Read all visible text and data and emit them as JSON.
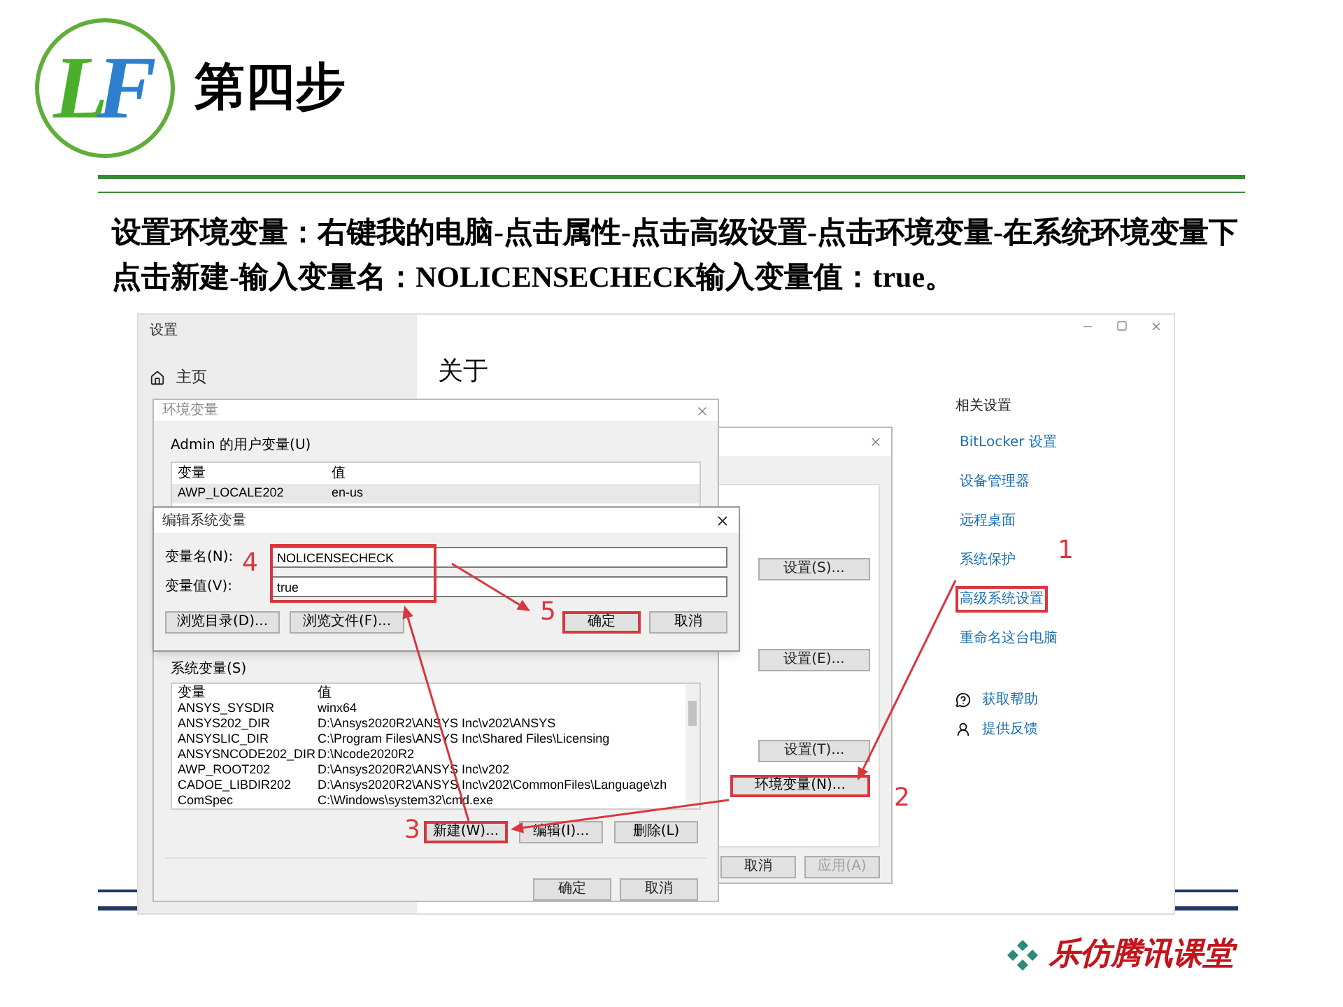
{
  "logo": {
    "letters": [
      "L",
      "F"
    ]
  },
  "title": "第四步",
  "instruction": "设置环境变量：右键我的电脑-点击属性-点击高级设置-点击环境变量-在系统环境变量下点击新建-输入变量名：NOLICENSECHECK输入变量值：true。",
  "settings_window": {
    "title": "设置",
    "nav": [
      {
        "label": "主页"
      }
    ],
    "page_title": "关于",
    "related_heading": "相关设置",
    "related_links": [
      {
        "label": "BitLocker 设置",
        "highlighted": false
      },
      {
        "label": "设备管理器",
        "highlighted": false
      },
      {
        "label": "远程桌面",
        "highlighted": false
      },
      {
        "label": "系统保护",
        "highlighted": false
      },
      {
        "label": "高级系统设置",
        "highlighted": true
      },
      {
        "label": "重命名这台电脑",
        "highlighted": false
      }
    ],
    "support_links": [
      {
        "label": "获取帮助",
        "kind": "help"
      },
      {
        "label": "提供反馈",
        "kind": "feedback"
      }
    ]
  },
  "system_properties": {
    "settings_buttons": [
      "设置(S)...",
      "设置(E)...",
      "设置(T)..."
    ],
    "env_button": {
      "label": "环境变量(N)...",
      "highlighted": true
    },
    "footer_buttons": [
      {
        "label": "取消",
        "disabled": false
      },
      {
        "label": "应用(A)",
        "disabled": true
      }
    ]
  },
  "env_window": {
    "title": "环境变量",
    "user_section": "Admin 的用户变量(U)",
    "user_columns": [
      "变量",
      "值"
    ],
    "user_rows": [
      {
        "name": "AWP_LOCALE202",
        "value": "en-us",
        "selected": true
      }
    ],
    "system_section": "系统变量(S)",
    "system_columns": [
      "变量",
      "值"
    ],
    "system_rows": [
      {
        "name": "ANSYS_SYSDIR",
        "value": "winx64"
      },
      {
        "name": "ANSYS202_DIR",
        "value": "D:\\Ansys2020R2\\ANSYS Inc\\v202\\ANSYS"
      },
      {
        "name": "ANSYSLIC_DIR",
        "value": "C:\\Program Files\\ANSYS Inc\\Shared Files\\Licensing"
      },
      {
        "name": "ANSYSNCODE202_DIR",
        "value": "D:\\Ncode2020R2"
      },
      {
        "name": "AWP_ROOT202",
        "value": "D:\\Ansys2020R2\\ANSYS Inc\\v202"
      },
      {
        "name": "CADOE_LIBDIR202",
        "value": "D:\\Ansys2020R2\\ANSYS Inc\\v202\\CommonFiles\\Language\\zh"
      },
      {
        "name": "ComSpec",
        "value": "C:\\Windows\\system32\\cmd.exe"
      }
    ],
    "action_buttons": [
      {
        "label": "新建(W)...",
        "highlighted": true
      },
      {
        "label": "编辑(I)...",
        "highlighted": false
      },
      {
        "label": "删除(L)",
        "highlighted": false
      }
    ],
    "footer_buttons": [
      "确定",
      "取消"
    ]
  },
  "edit_dialog": {
    "title": "编辑系统变量",
    "fields": [
      {
        "label": "变量名(N):",
        "value": "NOLICENSECHECK"
      },
      {
        "label": "变量值(V):",
        "value": "true"
      }
    ],
    "buttons": [
      {
        "label": "浏览目录(D)...",
        "highlighted": false
      },
      {
        "label": "浏览文件(F)...",
        "highlighted": false
      },
      {
        "label": "确定",
        "highlighted": true
      },
      {
        "label": "取消",
        "highlighted": false
      }
    ]
  },
  "annotations": {
    "steps": [
      "1",
      "2",
      "3",
      "4",
      "5"
    ]
  },
  "footer_brand": "乐仿腾讯课堂"
}
